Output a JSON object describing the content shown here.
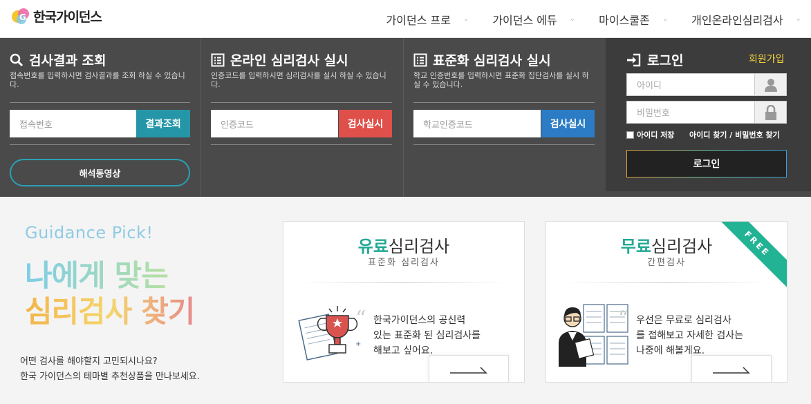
{
  "header": {
    "logo_text": "한국가이던스",
    "nav": [
      {
        "label": "가이던스 프로"
      },
      {
        "label": "가이던스 에듀"
      },
      {
        "label": "마이스쿨존"
      },
      {
        "label": "개인온라인심리검사"
      }
    ]
  },
  "panel": {
    "result": {
      "title": "검사결과 조회",
      "desc": "접속번호를 입력하시면 검사결과를 조회 하실 수 있습니다.",
      "placeholder": "접속번호",
      "button": "결과조회",
      "video_button": "해석동영상",
      "button_color": "#2496a8"
    },
    "online": {
      "title": "온라인 심리검사 실시",
      "desc": "인증코드를 입력하시면 심리검사를 실시 하실 수 있습니다.",
      "placeholder": "인증코드",
      "button": "검사실시",
      "button_color": "#e0504a"
    },
    "standard": {
      "title": "표준화 심리검사 실시",
      "desc": "학교 인증번호를 입력하시면 표준화 집단검사를 실시 하실 수 있습니다.",
      "placeholder": "학교인증코드",
      "button": "검사실시",
      "button_color": "#2b7cc4"
    },
    "login": {
      "title": "로그인",
      "join": "회원가입",
      "id_placeholder": "아이디",
      "pw_placeholder": "비밀번호",
      "remember": "아이디 저장",
      "find": "아이디 찾기 / 비밀번호 찾기",
      "button": "로그인"
    }
  },
  "lower": {
    "pick": "Guidance Pick!",
    "line1": "나에게 맞는",
    "line2": "심리검사 찾기",
    "intro1": "어떤 검사를 해야할지 고민되시나요?",
    "intro2": "한국 가이던스의 테마별 추천상품을 만나보세요.",
    "cards": [
      {
        "title_hl": "유료",
        "title_rest": "심리검사",
        "sub": "표준화 심리검사",
        "quote": [
          "한국가이던스의 공신력",
          "있는 표준화 된 심리검사를",
          "해보고 싶어요."
        ],
        "icon": "trophy-icon"
      },
      {
        "title_hl": "무료",
        "title_rest": "심리검사",
        "sub": "간편검사",
        "ribbon": "FREE",
        "quote": [
          "우선은 무료로 심리검사",
          "를 접해보고 자세한 검사는",
          "나중에 해볼게요."
        ],
        "icon": "person-reading-icon"
      }
    ]
  }
}
